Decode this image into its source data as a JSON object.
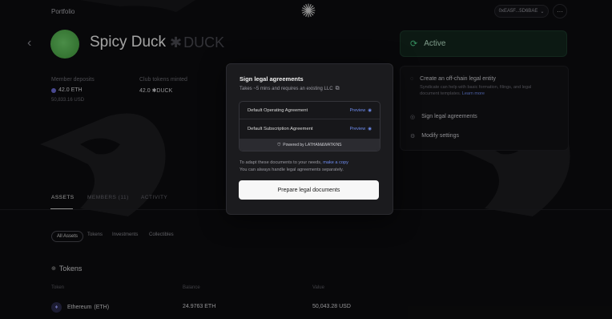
{
  "topbar": {
    "portfolio": "Portfolio",
    "wallet": "0xEA5F...5D6BAE",
    "more": "···"
  },
  "club": {
    "name": "Spicy Duck",
    "ticker": "DUCK"
  },
  "stats": {
    "deposits_label": "Member deposits",
    "deposits_value": "42.0 ETH",
    "deposits_sub": "50,833.16 USD",
    "tokens_label": "Club tokens minted",
    "tokens_value": "42.0 ✱DUCK"
  },
  "tabs": [
    "ASSETS",
    "MEMBERS (11)",
    "ACTIVITY"
  ],
  "filters": [
    "All Assets",
    "Tokens",
    "Investments",
    "Collectibles"
  ],
  "tokens": {
    "heading": "Tokens",
    "headers": [
      "Token",
      "Balance",
      "Value"
    ],
    "rows": [
      {
        "name": "Ethereum",
        "symbol": "(ETH)",
        "balance": "24.9763",
        "balance_unit": "ETH",
        "value": "50,043.28",
        "value_unit": "USD"
      }
    ]
  },
  "status": {
    "label": "Active"
  },
  "actions": [
    {
      "title": "Create an off-chain legal entity",
      "desc": "Syndicate can help with basic formation, filings, and legal document templates.",
      "link": "Learn more"
    },
    {
      "title": "Sign legal agreements"
    },
    {
      "title": "Modify settings"
    }
  ],
  "modal": {
    "title": "Sign legal agreements",
    "subtitle": "Takes ~5 mins and requires an existing LLC",
    "documents": [
      {
        "name": "Default Operating Agreement",
        "action": "Preview"
      },
      {
        "name": "Default Subscription Agreement",
        "action": "Preview"
      }
    ],
    "powered_by": "Powered by LATHAM&WATKINS",
    "note_prefix": "To adapt these documents to your needs,",
    "note_link": "make a copy",
    "note_line2": "You can always handle legal agreements separately.",
    "button": "Prepare legal documents"
  },
  "colors": {
    "background": "#0d0d0f",
    "active_card": "#12261d",
    "link": "#6f8df0",
    "avatar": "#5cc158"
  }
}
